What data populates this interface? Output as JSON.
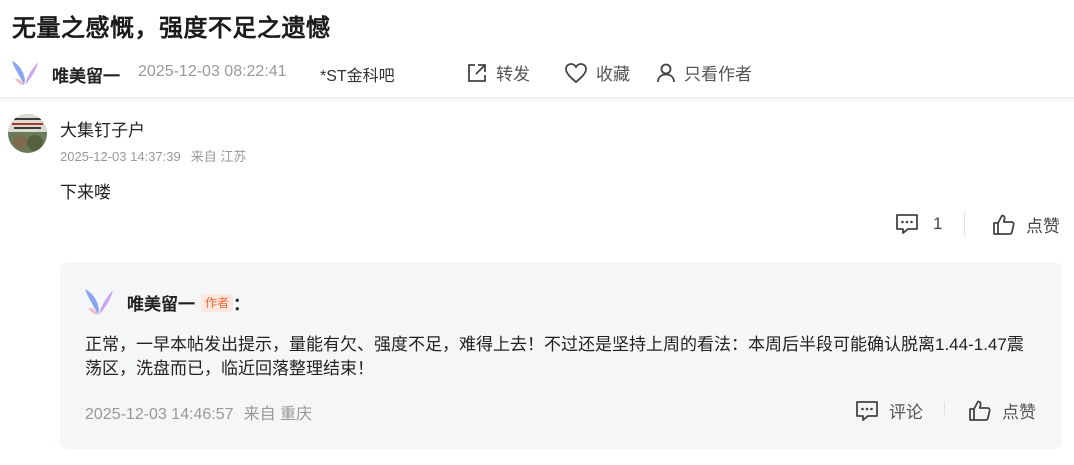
{
  "post": {
    "title": "无量之感慨，强度不足之遗憾",
    "author": "唯美留一",
    "time": "2025-12-03 08:22:41",
    "forum": "*ST金科吧",
    "actions": {
      "share": "转发",
      "favorite": "收藏",
      "author_only": "只看作者"
    }
  },
  "comment": {
    "user": "大集钉子户",
    "time": "2025-12-03 14:37:39",
    "location": "来自 江苏",
    "text": "下来喽",
    "reply_count": "1",
    "like_label": "点赞"
  },
  "reply": {
    "user": "唯美留一",
    "author_tag": "作者",
    "colon": "：",
    "text": "正常，一早本帖发出提示，量能有欠、强度不足，难得上去！不过还是坚持上周的看法：本周后半段可能确认脱离1.44-1.47震荡区，洗盘而已，临近回落整理结束！",
    "time": "2025-12-03 14:46:57",
    "location": "来自 重庆",
    "comment_label": "评论",
    "like_label": "点赞"
  },
  "icons": {
    "share": "share-icon",
    "favorite": "heart-icon",
    "author_only": "user-icon",
    "comment": "comment-icon",
    "like": "thumbs-up-icon",
    "avatar_logo": "butterfly-logo-icon"
  }
}
